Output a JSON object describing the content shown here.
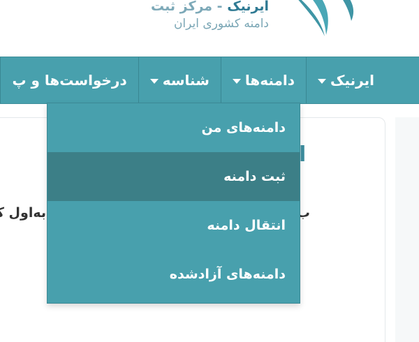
{
  "logo": {
    "brand": "ایرنیک",
    "tagline": " - مرکز ثبت",
    "subtitle": "دامنه کشوری ایران"
  },
  "navbar": {
    "items": [
      {
        "label": "ایرنیک",
        "has_caret": true
      },
      {
        "label": "دامنه‌ها",
        "has_caret": true
      },
      {
        "label": "شناسه",
        "has_caret": true
      },
      {
        "label": "درخواست‌ها و پ",
        "has_caret": false
      }
    ]
  },
  "dropdown": {
    "items": [
      {
        "label": "دامنه‌های من"
      },
      {
        "label": "ثبت دامنه"
      },
      {
        "label": "انتقال دامنه"
      },
      {
        "label": "دامنه‌های آزادشده"
      }
    ],
    "active_index": 1
  },
  "content": {
    "heading_fragment": "ا",
    "text_right_fragment": "ب",
    "text_left_fragment": "به‌اول ک"
  },
  "colors": {
    "navbar_bg": "#48a0ad",
    "dropdown_active_bg": "#3c7f87",
    "brand": "#2f7a93"
  }
}
